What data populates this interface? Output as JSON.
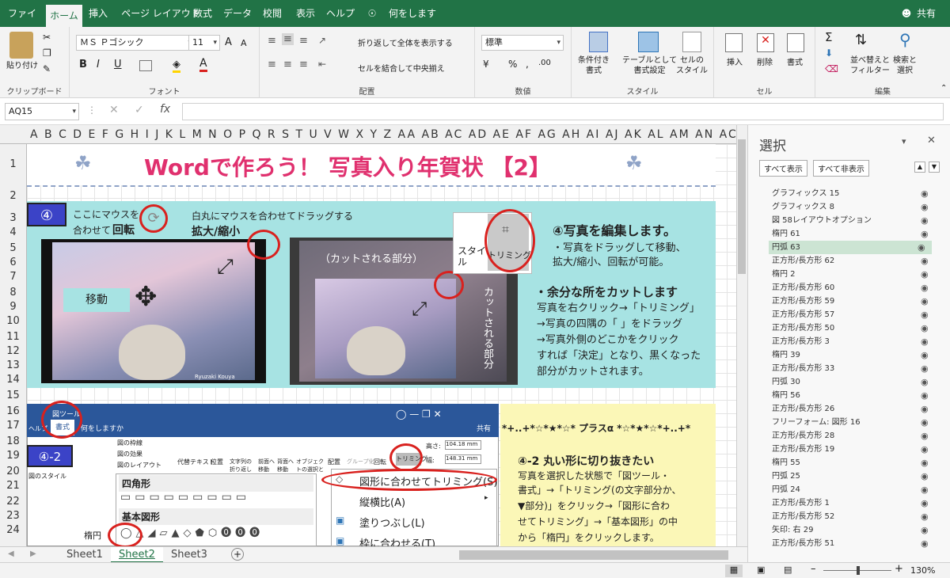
{
  "tabs": [
    "ファイル",
    "ホーム",
    "挿入",
    "ページ レイアウト",
    "数式",
    "データ",
    "校閲",
    "表示",
    "ヘルプ"
  ],
  "tell_me": "何をしますか",
  "share": "共有",
  "ribbon": {
    "clipboard": {
      "paste": "貼り付け",
      "label": "クリップボード"
    },
    "font": {
      "name": "ＭＳ Ｐゴシック",
      "size": "11",
      "label": "フォント",
      "bold": "B",
      "italic": "I",
      "underline": "U",
      "grow": "A",
      "shrink": "A"
    },
    "align": {
      "wrap": "折り返して全体を表示する",
      "merge": "セルを結合して中央揃え",
      "label": "配置"
    },
    "number": {
      "format": "標準",
      "label": "数値"
    },
    "styles": {
      "cond": "条件付き\n書式",
      "table": "テーブルとして\n書式設定",
      "cell": "セルの\nスタイル",
      "label": "スタイル"
    },
    "cells": {
      "insert": "挿入",
      "delete": "削除",
      "format": "書式",
      "label": "セル"
    },
    "edit": {
      "sort": "並べ替えと\nフィルター",
      "find": "検索と\n選択",
      "label": "編集"
    }
  },
  "formula": {
    "namebox": "AQ15",
    "fx": "fx"
  },
  "columns": "A B C D E F G H I J K L M N O P Q R S T U V W X Y Z AA AB AC AD AE AF AG AH AI AJ AK AL AM AN AC",
  "rows": [
    "1",
    "2",
    "3",
    "4",
    "5",
    "6",
    "7",
    "8",
    "9",
    "10",
    "11",
    "12",
    "13",
    "14",
    "15",
    "16",
    "17",
    "18",
    "19",
    "20",
    "21",
    "22",
    "23",
    "24"
  ],
  "doc": {
    "title": "Wordで作ろう！ 写真入り年賀状 【2】",
    "step4": "④",
    "hint_rotate_1": "ここにマウスを",
    "hint_rotate_2a": "合わせて",
    "hint_rotate_2b": "回転",
    "hint_drag": "白丸にマウスを合わせてドラッグする",
    "hint_resize": "拡大/縮小",
    "move": "移動",
    "cut_part": "（カットされる部分）",
    "cut_part_v": "カットされる部分",
    "style_btn": "スタイル",
    "trim_btn": "トリミング",
    "photo_credit": "Ryuzaki Kouya",
    "edit_title": "④写真を編集します。",
    "edit_body": [
      "・写真をドラッグして移動、",
      "拡大/縮小、回転が可能。"
    ],
    "cut_title": "・余分な所をカットします",
    "cut_body": [
      "写真を右クリック→「トリミング」",
      "→写真の四隅の「 」をドラッグ",
      "→写真外側のどこかをクリック",
      "すれば「決定」となり、黒くなった",
      "部分がカットされます。"
    ],
    "step42": "④-2",
    "plus": "*+..+*☆*★*☆* プラスα *☆*★*☆*+..+*",
    "s42_title": "④-2 丸い形に切り抜きたい",
    "s42_body": [
      "写真を選択した状態で「図ツール・",
      "書式」→「トリミング(の文字部分か、",
      "▼部分)」をクリック→「図形に合わ",
      "せてトリミング」→「基本図形」の中",
      "から「楕円」をクリックします。"
    ],
    "ss_tool": "図ツール",
    "ss_tab": "書式",
    "ss_help": "ヘルプ",
    "ss_tell": "何をしますか",
    "ss_share": "共有",
    "ss_border": "図の枠線",
    "ss_effect": "図の効果",
    "ss_layout": "図のレイアウト",
    "ss_style": "図のスタイル",
    "ss_alt": "代替テキスト",
    "ss_pos": "位置",
    "ss_wrap": "文字列の折り返し",
    "ss_front": "前面へ移動",
    "ss_back": "背面へ移動",
    "ss_pane": "オブジェクトの選択と表示",
    "ss_align": "配置",
    "ss_group": "グループ化",
    "ss_rotate": "回転",
    "ss_trim": "トリミング",
    "ss_h": "高さ:",
    "ss_hv": "104.18 mm",
    "ss_w": "幅:",
    "ss_wv": "148.31 mm",
    "rect": "四角形",
    "basic": "基本図形",
    "ellipse": "楕円",
    "menu": [
      "図形に合わせてトリミング(S)",
      "縦横比(A)",
      "塗りつぶし(L)",
      "枠に合わせる(T)"
    ]
  },
  "pane": {
    "title": "選択",
    "show_all": "すべて表示",
    "hide_all": "すべて非表示",
    "items": [
      "グラフィックス 15",
      "グラフィックス 8",
      "図 58レイアウトオプション",
      "楕円 61",
      "円弧 63",
      "正方形/長方形 62",
      "楕円 2",
      "正方形/長方形 60",
      "正方形/長方形 59",
      "正方形/長方形 57",
      "正方形/長方形 50",
      "正方形/長方形 3",
      "楕円 39",
      "正方形/長方形 33",
      "円弧 30",
      "楕円 56",
      "正方形/長方形 26",
      "フリーフォーム: 図形 16",
      "正方形/長方形 28",
      "正方形/長方形 19",
      "楕円 55",
      "円弧 25",
      "円弧 24",
      "正方形/長方形 1",
      "正方形/長方形 52",
      "矢印: 右 29",
      "正方形/長方形 51"
    ],
    "selected_index": 4
  },
  "sheets": [
    "Sheet1",
    "Sheet2",
    "Sheet3"
  ],
  "zoom": "130%",
  "colors": {
    "green": "#217346",
    "title": "#e0306e",
    "teal": "#a7e3e3",
    "yellow": "#fbf7b7",
    "red": "#d9211e"
  }
}
